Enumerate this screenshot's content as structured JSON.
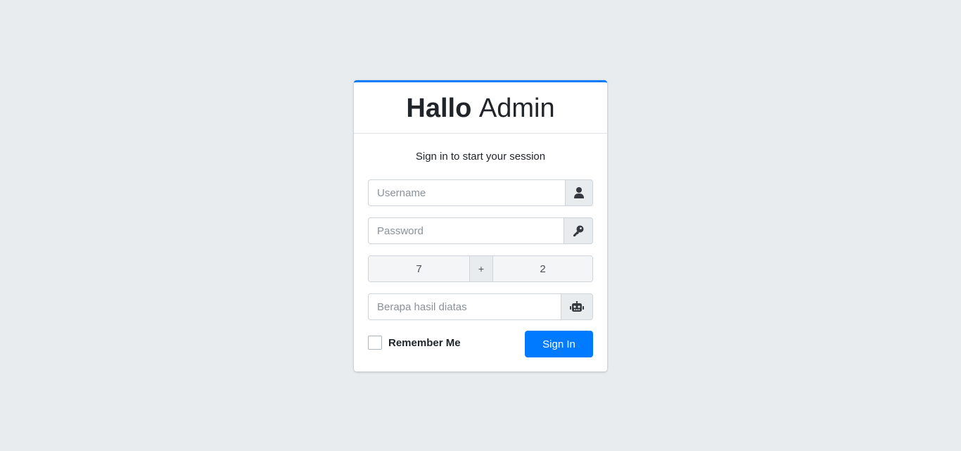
{
  "header": {
    "brand_bold": "Hallo",
    "brand_light": "Admin"
  },
  "login": {
    "message": "Sign in to start your session",
    "username_placeholder": "Username",
    "password_placeholder": "Password",
    "captcha": {
      "left": "7",
      "operator": "+",
      "right": "2",
      "answer_placeholder": "Berapa hasil diatas"
    },
    "remember_label": "Remember Me",
    "signin_label": "Sign In"
  },
  "icons": {
    "username": "user-icon",
    "password": "key-icon",
    "captcha": "robot-icon"
  },
  "colors": {
    "accent": "#007bff",
    "background": "#e9ecef",
    "card": "#ffffff"
  }
}
